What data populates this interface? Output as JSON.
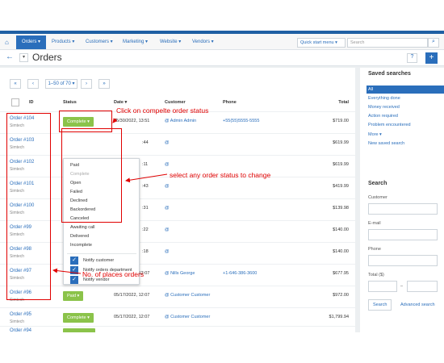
{
  "nav": {
    "tab_orders": "Orders ▾",
    "menu": [
      "Products ▾",
      "Customers ▾",
      "Marketing ▾",
      "Website ▾",
      "Vendors ▾"
    ],
    "quick_start": "Quick start menu ▾",
    "search_placeholder": "Search"
  },
  "header": {
    "title": "Orders"
  },
  "pager": {
    "first": "«",
    "prev": "‹",
    "range": "1–50 of 70 ▾",
    "next": "›",
    "last": "»"
  },
  "table": {
    "headers": {
      "id": "ID",
      "status": "Status",
      "date": "Date ▾",
      "customer": "Customer",
      "phone": "Phone",
      "total": "Total"
    },
    "rows": [
      {
        "id": "Order #104",
        "company": "Simtech",
        "status": "Complete ▾",
        "date": "05/30/2022, 13:51",
        "customer": "@ Admin Admin",
        "phone": "+55(55)5555-5555",
        "total": "$719.00"
      },
      {
        "id": "Order #103",
        "company": "Simtech",
        "date_tail": ":44",
        "customer": "@",
        "total": "$619.99"
      },
      {
        "id": "Order #102",
        "company": "Simtech",
        "date_tail": ":11",
        "customer": "@",
        "total": "$619.99"
      },
      {
        "id": "Order #101",
        "company": "Simtech",
        "date_tail": ":43",
        "customer": "@",
        "total": "$419.99"
      },
      {
        "id": "Order #100",
        "company": "Simtech",
        "date_tail": ":31",
        "customer": "@",
        "total": "$139.98"
      },
      {
        "id": "Order #99",
        "company": "Simtech",
        "date_tail": ":22",
        "customer": "@",
        "total": "$140.00"
      },
      {
        "id": "Order #98",
        "company": "Simtech",
        "date_tail": ":18",
        "customer": "@",
        "total": "$140.00"
      },
      {
        "id": "Order #97",
        "company": "Simtech",
        "date": "05/17/2022, 12:07",
        "customer": "@ Nills George",
        "phone": "+1-646-386-3600",
        "total": "$677.95"
      },
      {
        "id": "Order #96",
        "company": "Simtech",
        "status": "Paid ▾",
        "date": "05/17/2022, 12:07",
        "customer": "@ Customer Customer",
        "total": "$972.00"
      },
      {
        "id": "Order #95",
        "company": "Simtech",
        "status": "Complete ▾",
        "date": "05/17/2022, 12:07",
        "customer": "@ Customer Customer",
        "total": "$1,799.94"
      },
      {
        "id": "Order #94"
      }
    ]
  },
  "status_menu": {
    "options": [
      "Paid",
      "Complete",
      "Open",
      "Failed",
      "Declined",
      "Backordered",
      "Canceled",
      "Awaiting call",
      "Delivered",
      "Incomplete"
    ],
    "notify": [
      "Notify customer",
      "Notify orders department",
      "Notify vendor"
    ]
  },
  "sidebar": {
    "saved_title": "Saved searches",
    "saved": [
      "All",
      "Everything done",
      "Money received",
      "Action required",
      "Problem encountered",
      "More ▾",
      "New saved search"
    ],
    "search_title": "Search",
    "customer_label": "Customer",
    "email_label": "E-mail",
    "phone_label": "Phone",
    "total_label": "Total ($)",
    "range_sep": "–",
    "search_button": "Search",
    "advanced_link": "Advanced search"
  },
  "annotations": {
    "click_status": "Click on compelte order status",
    "select_status": "select any order status to change",
    "places_orders": "No. of places orders"
  },
  "colors": {
    "accent": "#2a6ebb",
    "complete": "#8bc34a",
    "open": "#f5a623",
    "annotation": "#e00000"
  }
}
